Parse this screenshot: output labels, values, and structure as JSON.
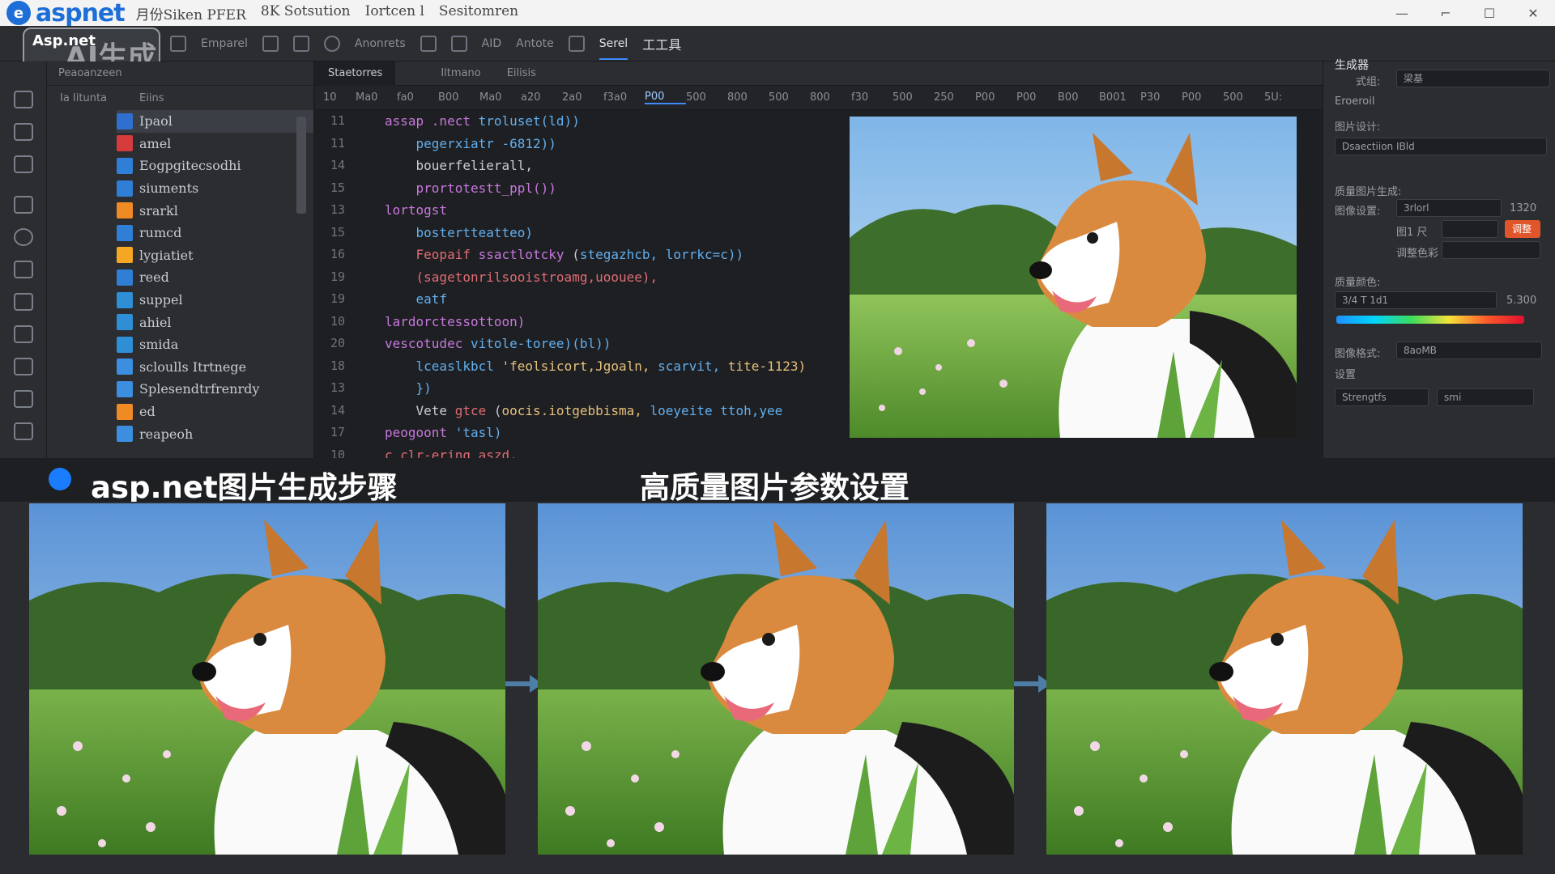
{
  "titlebar": {
    "logo_letter": "e",
    "logo_text": "aspnet",
    "menu": [
      "月份Siken PFER",
      "8K Sotsution",
      "Iortcen l",
      "Sesitomren"
    ],
    "controls": [
      "—",
      "⌐",
      "☐",
      "✕"
    ]
  },
  "toolbar": {
    "items": [
      "Asp.net",
      "Emparel",
      "Anonrets",
      "AID",
      "Antote",
      "Serel",
      "工工具"
    ],
    "active": "工工具"
  },
  "watermark": {
    "small": "Asp.net",
    "big": "AI生成"
  },
  "explorer": {
    "header": "Peaoanzeen",
    "sub_left": "Ia  Iitunta",
    "sub_right": "Eiins",
    "tree": [
      {
        "label": "Ipaol",
        "color": "#2f6fd0"
      },
      {
        "label": "amel",
        "color": "#d63b3b"
      },
      {
        "label": "Eogpgitecsodhi",
        "color": "#2f7fd6"
      },
      {
        "label": "siuments",
        "color": "#2f7fd6"
      },
      {
        "label": "srarkl",
        "color": "#f08a24"
      },
      {
        "label": "rumcd",
        "color": "#2f7fd6"
      },
      {
        "label": "lygiatiet",
        "color": "#f5a623"
      },
      {
        "label": "reed",
        "color": "#2f7fd6"
      },
      {
        "label": "suppel",
        "color": "#2f8fd6"
      },
      {
        "label": "ahiel",
        "color": "#2f8fd6"
      },
      {
        "label": "smida",
        "color": "#2f8fd6"
      },
      {
        "label": "scloulls Itrtnege",
        "color": "#3b8ee0"
      },
      {
        "label": "Splesendtrfrenrdy",
        "color": "#3b8ee0"
      },
      {
        "label": "ed",
        "color": "#f08a24"
      },
      {
        "label": "reapeoh",
        "color": "#3b8ee0"
      }
    ]
  },
  "editor": {
    "tabs": [
      "Staetorres",
      "Iltmano",
      "Eilisis"
    ],
    "ruler": [
      "Ma0",
      "fa0",
      "B00",
      "Ma0",
      "a20",
      "2a0",
      "f3a0",
      "P00",
      "500",
      "800",
      "500",
      "800",
      "f30",
      "500",
      "250",
      "P00",
      "P00",
      "B00",
      "B001",
      "P30",
      "P00",
      "500",
      "5U:"
    ],
    "ruler_highlight": "P00",
    "line_numbers": [
      "11",
      "11",
      "14",
      "15",
      "13",
      "15",
      "16",
      "19",
      "19",
      "10",
      "20",
      "18",
      "13",
      "14",
      "17",
      "10"
    ],
    "code": [
      [
        {
          "t": "assap .nect ",
          "c": "kw"
        },
        {
          "t": "troluset(ld))",
          "c": "fn"
        }
      ],
      [
        {
          "t": "    pegerxiatr -6812))",
          "c": "fn"
        }
      ],
      [
        {
          "t": "    bouerfelierall,",
          "c": "plain"
        }
      ],
      [
        {
          "t": "    prortotestt_ppl())",
          "c": "kw"
        }
      ],
      [
        {
          "t": "lortogst",
          "c": "kw"
        }
      ],
      [
        {
          "t": "    bostertteatteo)",
          "c": "fn"
        }
      ],
      [
        {
          "t": "    Feopaif ",
          "c": "red"
        },
        {
          "t": "ssactlotcky",
          "c": "kw"
        },
        {
          "t": " (",
          "c": "plain"
        },
        {
          "t": "stegazhcb, lorrkc=c))",
          "c": "fn"
        }
      ],
      [
        {
          "t": "    (sagetonrilsooistroamg,uoouee),",
          "c": "red"
        }
      ],
      [
        {
          "t": "    eatf",
          "c": "fn"
        }
      ],
      [
        {
          "t": "lardorctessottoon)",
          "c": "kw"
        }
      ],
      [
        {
          "t": "vescotudec ",
          "c": "kw"
        },
        {
          "t": "vitole-toree)(bl))",
          "c": "fn"
        }
      ],
      [
        {
          "t": "    lceaslkbcl ",
          "c": "fn"
        },
        {
          "t": "'feolsicort,Jgoaln,",
          "c": "str"
        },
        {
          "t": " scarvit, ",
          "c": "fn"
        },
        {
          "t": "tite-1123)",
          "c": "str"
        }
      ],
      [
        {
          "t": "    })",
          "c": "fn"
        }
      ],
      [
        {
          "t": "    Vete ",
          "c": "plain"
        },
        {
          "t": "gtce",
          "c": "red"
        },
        {
          "t": " (",
          "c": "plain"
        },
        {
          "t": "oocis.iotgebbisma,",
          "c": "str"
        },
        {
          "t": " loeyeite ttoh,yee",
          "c": "fn"
        }
      ],
      [
        {
          "t": "peogoont ",
          "c": "kw"
        },
        {
          "t": "'tasl)",
          "c": "fn"
        }
      ],
      [
        {
          "t": "c clr-ering aszd,",
          "c": "red"
        }
      ]
    ]
  },
  "right_panel": {
    "title": "生成器",
    "style_label": "式组:",
    "style_value": "梁基",
    "general_label": "Eroeroil",
    "params_label": "图片设计:",
    "mode_value": "Dsaectiion IBld",
    "quality_label": "质量图片生成:",
    "res_label": "图像设置:",
    "res_value": "3rlorl",
    "res_num": "1320",
    "ratio_label": "图1 尺",
    "btn_label": "调整",
    "blend_label": "调整色彩",
    "color_label": "质量颜色:",
    "color_field": "3/4 T 1d1",
    "color_num": "5.300",
    "format_label": "图像格式:",
    "format_value": "8aoMB",
    "settings_label": "设置",
    "strength_label": "Strengtfs",
    "toggle_label": "smi"
  },
  "headings": {
    "left": "asp.net图片生成步骤",
    "center": "高质量图片参数设置"
  },
  "colors": {
    "accent": "#1a7dff",
    "arrow": "#4e7da6"
  }
}
